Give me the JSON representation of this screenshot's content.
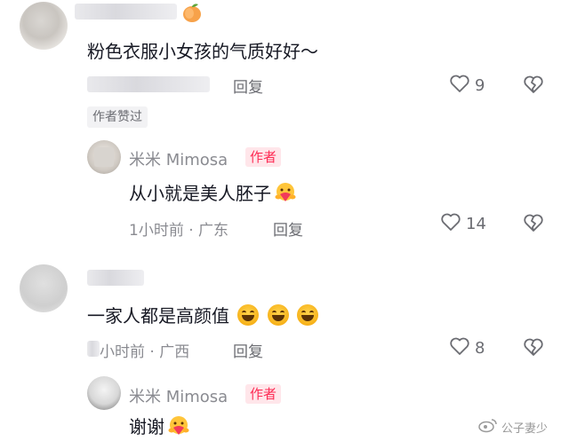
{
  "comments": [
    {
      "text": "粉色衣服小女孩的气质好好～",
      "reply_label": "回复",
      "likes": "9",
      "liked_by_author": "作者赞过"
    },
    {
      "author": "米米 Mimosa",
      "badge": "作者",
      "text": "从小就是美人胚子",
      "time": "1小时前 · 广东",
      "reply_label": "回复",
      "likes": "14"
    },
    {
      "text": "一家人都是高颜值",
      "time": "小时前 · 广西",
      "reply_label": "回复",
      "likes": "8"
    },
    {
      "author": "米米 Mimosa",
      "badge": "作者",
      "text": "谢谢"
    }
  ],
  "watermark": "公子妻少",
  "colors": {
    "badge_text": "#fe2c55",
    "badge_bg": "#ffe6ea",
    "muted": "#8a8b91"
  },
  "icons": [
    "heart-outline-icon",
    "broken-heart-icon",
    "laughing-emoji-icon",
    "heart-hug-emoji-icon",
    "weibo-logo-icon"
  ]
}
